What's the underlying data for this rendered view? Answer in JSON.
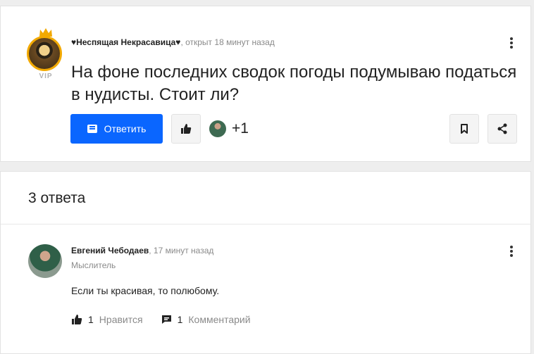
{
  "question": {
    "author": "♥Неспящая Некрасавица♥",
    "time": ", открыт 18 минут назад",
    "badge": "VIP",
    "title": "На фоне последних сводок погоды подумываю податься в нудисты. Стоит ли?",
    "answer_button": "Ответить",
    "likes_extra": "+1"
  },
  "answers": {
    "count_label": "3 ответа",
    "items": [
      {
        "author": "Евгений Чебодаев",
        "time": ", 17 минут назад",
        "role": "Мыслитель",
        "text": "Если ты красивая, то полюбому.",
        "likes": "1",
        "like_label": "Нравится",
        "comments": "1",
        "comment_label": "Комментарий"
      }
    ]
  },
  "icons": {
    "menu": "kebab-menu-icon",
    "like": "thumbs-up-icon",
    "bookmark": "bookmark-icon",
    "share": "share-icon",
    "comment": "chat-bubble-icon"
  },
  "colors": {
    "accent": "#0a66ff",
    "vip_ring": "#f2a900"
  }
}
